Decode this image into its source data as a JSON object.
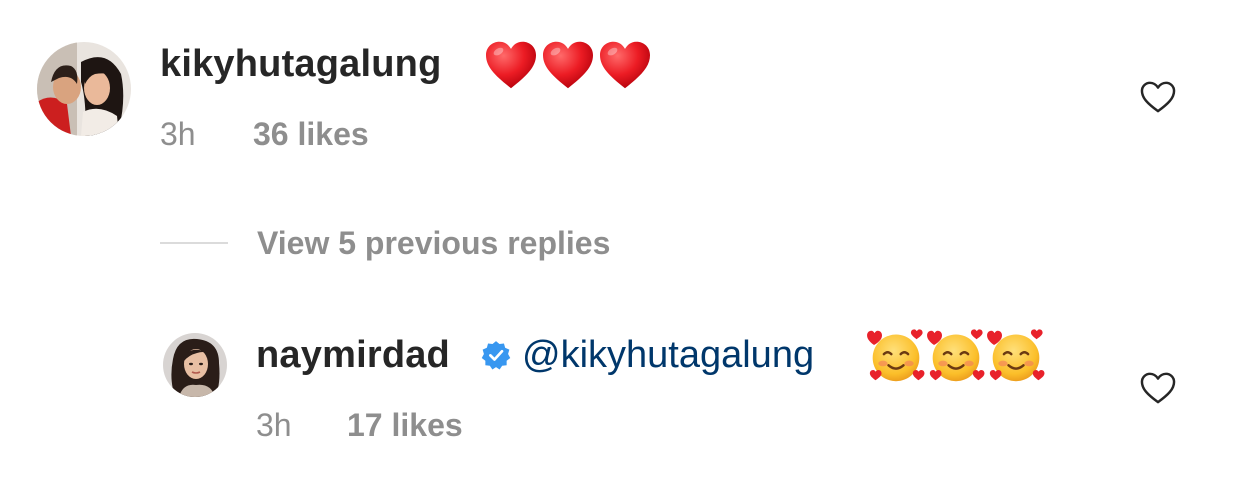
{
  "comments": [
    {
      "username": "kikyhutagalung",
      "emojis": [
        "red-heart-emoji",
        "red-heart-emoji",
        "red-heart-emoji"
      ],
      "time": "3h",
      "likes": "36 likes",
      "like_icon": "heart-outline-icon"
    },
    {
      "username": "naymirdad",
      "verified_icon": "verified-badge-icon",
      "mention": "@kikyhutagalung",
      "emojis": [
        "smiling-face-with-hearts-emoji",
        "smiling-face-with-hearts-emoji",
        "smiling-face-with-hearts-emoji"
      ],
      "time": "3h",
      "likes": "17 likes",
      "like_icon": "heart-outline-icon"
    }
  ],
  "replies": {
    "view_previous_label": "View 5 previous replies"
  },
  "colors": {
    "username": "#262626",
    "meta": "#8e8e8e",
    "mention": "#00376b",
    "verified": "#3897f0",
    "divider": "#dbdbdb",
    "heart_emoji": "#e0131b"
  }
}
